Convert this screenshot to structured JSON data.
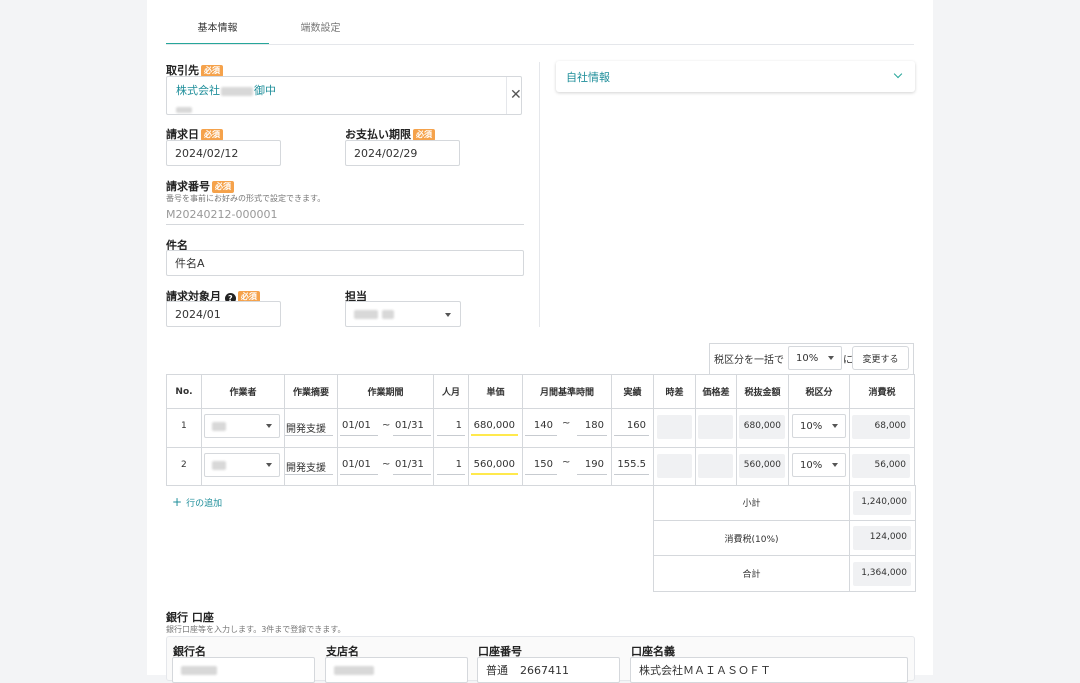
{
  "tabs": [
    {
      "label": "基本情報",
      "active": true
    },
    {
      "label": "端数設定",
      "active": false
    }
  ],
  "required_badge": "必須",
  "client": {
    "label": "取引先",
    "name_prefix": "株式会社",
    "name_suffix": "御中"
  },
  "invoice_date": {
    "label": "請求日",
    "value": "2024/02/12"
  },
  "due_date": {
    "label": "お支払い期限",
    "value": "2024/02/29"
  },
  "invoice_number": {
    "label": "請求番号",
    "hint": "番号を事前にお好みの形式で設定できます。",
    "value": "M20240212-000001"
  },
  "subject": {
    "label": "件名",
    "value": "件名A"
  },
  "target_month": {
    "label": "請求対象月",
    "value": "2024/01"
  },
  "assignee": {
    "label": "担当"
  },
  "company_panel": {
    "label": "自社情報"
  },
  "bulk_tax": {
    "prefix": "税区分を一括で",
    "value": "10%",
    "suffix": "に",
    "button": "変更する"
  },
  "table": {
    "headers": [
      "No.",
      "作業者",
      "作業摘要",
      "作業期間",
      "人月",
      "単価",
      "月間基準時間",
      "実績",
      "時差",
      "価格差",
      "税抜金額",
      "税区分",
      "消費税"
    ],
    "range_sep": "~",
    "rows": [
      {
        "no": "1",
        "summary": "開発支援",
        "period_from": "01/01",
        "period_to": "01/31",
        "man_month": "1",
        "unit_price": "680,000",
        "hours_min": "140",
        "hours_max": "180",
        "actual": "160",
        "amount": "680,000",
        "tax_rate": "10%",
        "tax": "68,000"
      },
      {
        "no": "2",
        "summary": "開発支援",
        "period_from": "01/01",
        "period_to": "01/31",
        "man_month": "1",
        "unit_price": "560,000",
        "hours_min": "150",
        "hours_max": "190",
        "actual": "155.5",
        "amount": "560,000",
        "tax_rate": "10%",
        "tax": "56,000"
      }
    ],
    "add_row": "行の追加",
    "totals": [
      {
        "label": "小計",
        "value": "1,240,000"
      },
      {
        "label": "消費税(10%)",
        "value": "124,000"
      },
      {
        "label": "合計",
        "value": "1,364,000"
      }
    ]
  },
  "bank": {
    "title": "銀行 口座",
    "hint": "銀行口座等を入力します。3件まで登録できます。",
    "fields": [
      "銀行名",
      "支店名",
      "口座番号",
      "口座名義"
    ],
    "account_type": "普通",
    "account_number": "2667411",
    "account_holder": "株式会社ＭＡＩＡＳＯＦＴ"
  },
  "colors": {
    "accent": "#26a69a",
    "required": "#f5a24b",
    "link": "#1e8e9a"
  }
}
